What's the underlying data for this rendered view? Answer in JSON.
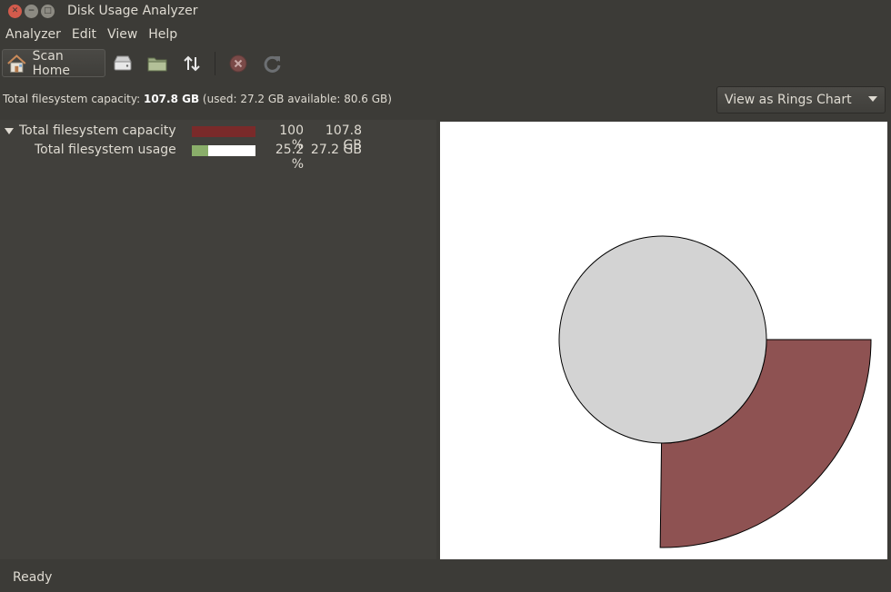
{
  "window": {
    "title": "Disk Usage Analyzer",
    "buttons": [
      "close",
      "minimize",
      "maximize"
    ]
  },
  "menu": {
    "items": [
      "Analyzer",
      "Edit",
      "View",
      "Help"
    ]
  },
  "toolbar": {
    "scan_home_label": "Scan Home",
    "icons": [
      "home-icon",
      "drive-icon",
      "folder-icon",
      "remote-icon",
      "stop-icon",
      "refresh-icon"
    ]
  },
  "info": {
    "prefix": "Total filesystem capacity: ",
    "capacity": "107.8 GB",
    "suffix": " (used: 27.2 GB available: 80.6 GB)"
  },
  "view_select": {
    "selected": "View as Rings Chart"
  },
  "tree": {
    "rows": [
      {
        "name": "Total filesystem capacity",
        "percent_text": "100 %",
        "percent": 100,
        "size": "107.8 GB",
        "bar_color": "#7a2a2a",
        "expanded": true
      },
      {
        "name": "Total filesystem usage",
        "percent_text": "25.2 %",
        "percent": 25.2,
        "size": "27.2 GB",
        "bar_color": "#8aae6a",
        "expanded": false
      }
    ]
  },
  "chart": {
    "type": "rings",
    "center_color": "#d3d3d3",
    "ring_color": "#8e5252",
    "used_fraction": 0.252
  },
  "status": {
    "text": "Ready"
  },
  "colors": {
    "window_bg": "#3c3b37",
    "pane_bg": "#41403c",
    "text": "#dfdbd2"
  }
}
